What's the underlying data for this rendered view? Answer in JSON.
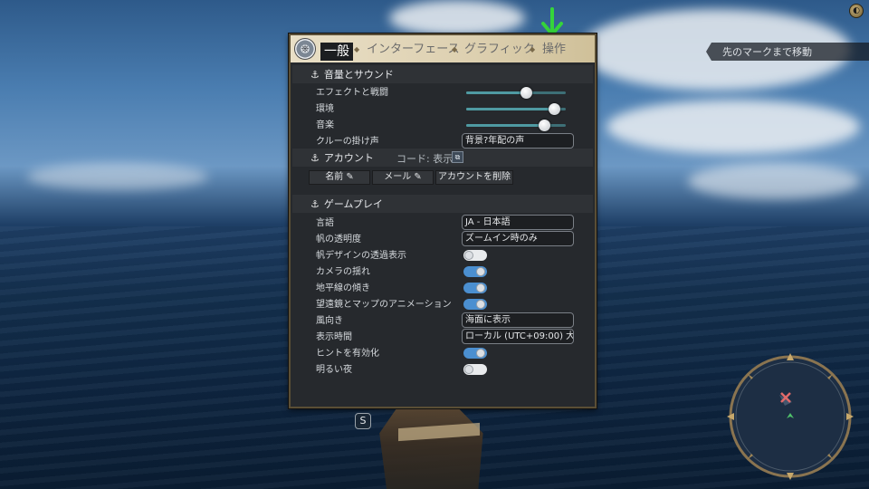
{
  "hud": {
    "nav_hint": "先のマークまで移動",
    "interact_key": "S"
  },
  "settings": {
    "tabs": [
      {
        "label": "一般",
        "active": true
      },
      {
        "label": "インターフェース",
        "active": false
      },
      {
        "label": "グラフィック",
        "active": false
      },
      {
        "label": "操作",
        "active": false
      }
    ],
    "sound": {
      "title": "音量とサウンド",
      "effects": {
        "label": "エフェクトと戦闘",
        "value": 0.6
      },
      "ambient": {
        "label": "環境",
        "value": 0.9
      },
      "music": {
        "label": "音楽",
        "value": 0.8
      },
      "crew_call": {
        "label": "クルーの掛け声",
        "value": "背景?年配の声"
      }
    },
    "account": {
      "title": "アカウント",
      "code_label": "コード: 表示",
      "name_button": "名前 ✎",
      "mail_button": "メール ✎",
      "delete_button": "アカウントを削除"
    },
    "gameplay": {
      "title": "ゲームプレイ",
      "language": {
        "label": "言語",
        "value": "JA - 日本語"
      },
      "sail_transparency": {
        "label": "帆の透明度",
        "value": "ズームイン時のみ"
      },
      "sail_design_transparent": {
        "label": "帆デザインの透過表示",
        "on": false
      },
      "camera_shake": {
        "label": "カメラの揺れ",
        "on": true
      },
      "horizon_tilt": {
        "label": "地平線の傾き",
        "on": true
      },
      "scope_map_anim": {
        "label": "望遠鏡とマップのアニメーション",
        "on": true
      },
      "wind_direction": {
        "label": "風向き",
        "value": "海面に表示"
      },
      "time_display": {
        "label": "表示時間",
        "value": "ローカル (UTC+09:00) 大..."
      },
      "hints": {
        "label": "ヒントを有効化",
        "on": true
      },
      "bright_night": {
        "label": "明るい夜",
        "on": false
      }
    }
  },
  "colors": {
    "toggle_on": "#4b8fd0",
    "toggle_off": "#e9ebed",
    "arrow": "#35d43a",
    "panel_bg": "#26292d"
  }
}
